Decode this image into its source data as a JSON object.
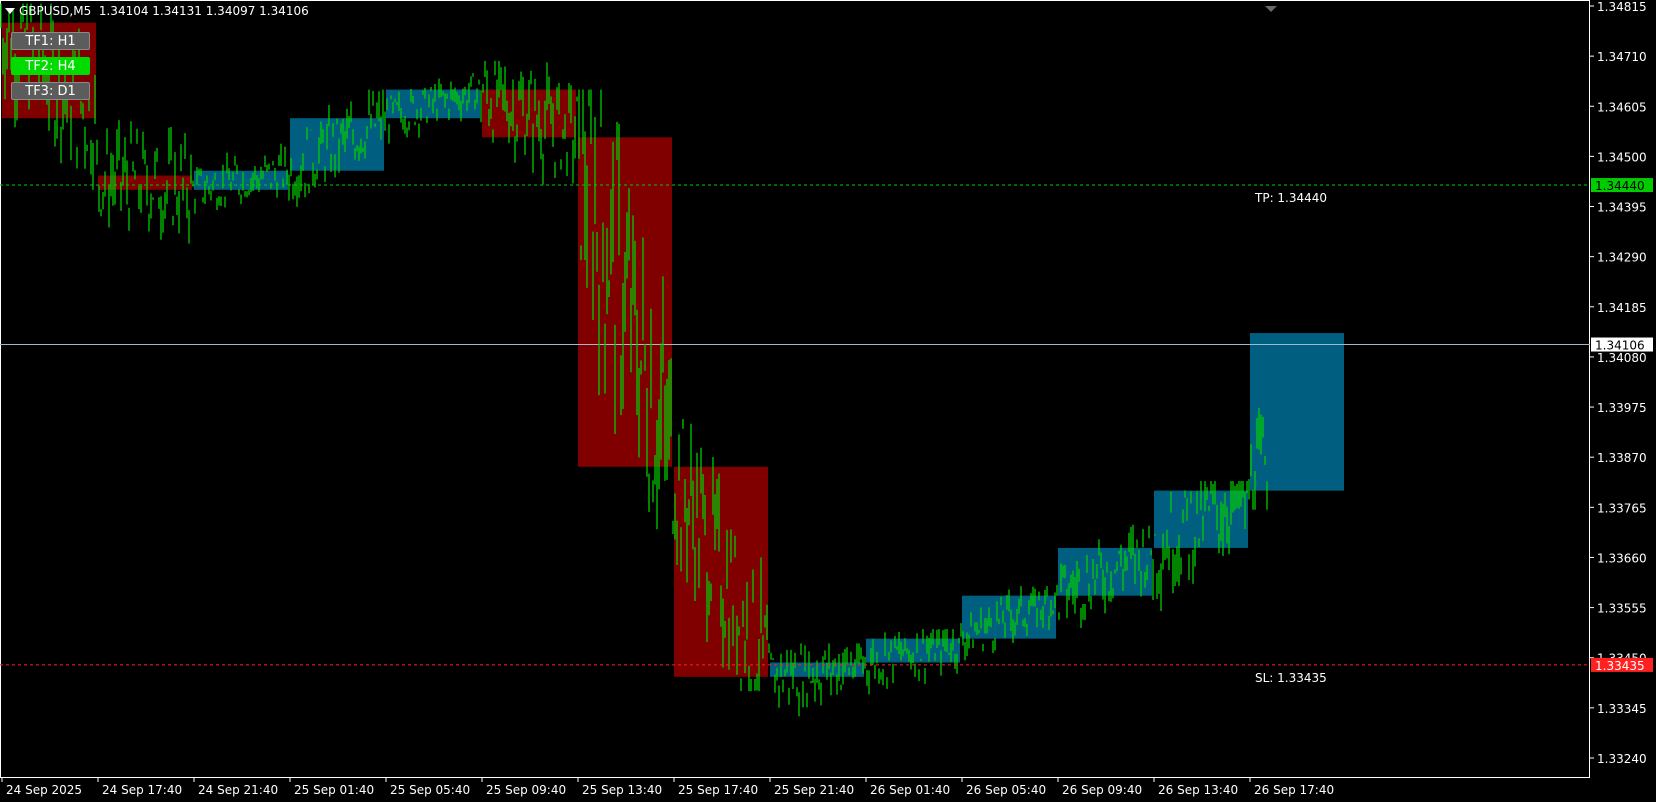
{
  "header": {
    "symbol": "GBPUSD,M5",
    "ohlc": "1.34104 1.34131 1.34097 1.34106"
  },
  "tf_buttons": [
    {
      "label": "TF1: H1",
      "active": false
    },
    {
      "label": "TF2: H4",
      "active": true
    },
    {
      "label": "TF3: D1",
      "active": false
    }
  ],
  "price_axis": {
    "labels": [
      "1.34815",
      "1.34710",
      "1.34605",
      "1.34500",
      "1.34395",
      "1.34290",
      "1.34185",
      "1.34080",
      "1.33975",
      "1.33870",
      "1.33765",
      "1.33660",
      "1.33555",
      "1.33450",
      "1.33345",
      "1.33240"
    ]
  },
  "time_axis": {
    "labels": [
      "24 Sep 2025",
      "24 Sep 17:40",
      "24 Sep 21:40",
      "25 Sep 01:40",
      "25 Sep 05:40",
      "25 Sep 09:40",
      "25 Sep 13:40",
      "25 Sep 17:40",
      "25 Sep 21:40",
      "26 Sep 01:40",
      "26 Sep 05:40",
      "26 Sep 09:40",
      "26 Sep 13:40",
      "26 Sep 17:40"
    ]
  },
  "levels": {
    "tp": {
      "label": "TP: 1.34440",
      "price": 1.3444,
      "tag": "1.34440",
      "color": "#00cc00"
    },
    "sl": {
      "label": "SL: 1.33435",
      "price": 1.33435,
      "tag": "1.33435",
      "color": "#ff2020"
    },
    "current": {
      "price": 1.34106,
      "tag": "1.34106",
      "color": "#a0b8d0"
    }
  },
  "colors": {
    "background": "#000000",
    "candle_green": "#00cc00",
    "bull_box": "#005f80",
    "bear_box": "#800000"
  },
  "chart_data": {
    "type": "candlestick",
    "symbol": "GBPUSD",
    "timeframe": "M5",
    "y_range": [
      1.3321,
      1.3482
    ],
    "current_price": 1.34106,
    "x_time_labels": [
      "24 Sep 2025",
      "24 Sep 17:40",
      "24 Sep 21:40",
      "25 Sep 01:40",
      "25 Sep 05:40",
      "25 Sep 09:40",
      "25 Sep 13:40",
      "25 Sep 17:40",
      "25 Sep 21:40",
      "26 Sep 01:40",
      "26 Sep 05:40",
      "26 Sep 09:40",
      "26 Sep 13:40",
      "26 Sep 17:40"
    ],
    "h4_boxes": [
      {
        "period": 1,
        "open": 1.3478,
        "close": 1.3458,
        "high": 1.348,
        "low": 1.3435,
        "dir": "bear"
      },
      {
        "period": 2,
        "open": 1.3446,
        "close": 1.3443,
        "high": 1.346,
        "low": 1.3428,
        "dir": "bear"
      },
      {
        "period": 3,
        "open": 1.3443,
        "close": 1.3447,
        "high": 1.3455,
        "low": 1.344,
        "dir": "bull"
      },
      {
        "period": 4,
        "open": 1.3447,
        "close": 1.3458,
        "high": 1.3462,
        "low": 1.344,
        "dir": "bull"
      },
      {
        "period": 5,
        "open": 1.3458,
        "close": 1.3464,
        "high": 1.3467,
        "low": 1.3453,
        "dir": "bull"
      },
      {
        "period": 6,
        "open": 1.3464,
        "close": 1.3454,
        "high": 1.3468,
        "low": 1.3436,
        "dir": "bear"
      },
      {
        "period": 7,
        "open": 1.3454,
        "close": 1.3385,
        "high": 1.3462,
        "low": 1.337,
        "dir": "bear"
      },
      {
        "period": 8,
        "open": 1.3385,
        "close": 1.3341,
        "high": 1.3393,
        "low": 1.334,
        "dir": "bear"
      },
      {
        "period": 9,
        "open": 1.3341,
        "close": 1.3344,
        "high": 1.3346,
        "low": 1.3323,
        "dir": "bull"
      },
      {
        "period": 10,
        "open": 1.3344,
        "close": 1.3349,
        "high": 1.3349,
        "low": 1.3331,
        "dir": "bull"
      },
      {
        "period": 11,
        "open": 1.3349,
        "close": 1.3358,
        "high": 1.3358,
        "low": 1.3342,
        "dir": "bull"
      },
      {
        "period": 12,
        "open": 1.3358,
        "close": 1.3368,
        "high": 1.3371,
        "low": 1.3348,
        "dir": "bull"
      },
      {
        "period": 13,
        "open": 1.3368,
        "close": 1.338,
        "high": 1.338,
        "low": 1.3347,
        "dir": "bull"
      },
      {
        "period": 14,
        "open": 1.338,
        "close": 1.3413,
        "high": 1.3413,
        "low": 1.3378,
        "dir": "bull"
      }
    ]
  }
}
